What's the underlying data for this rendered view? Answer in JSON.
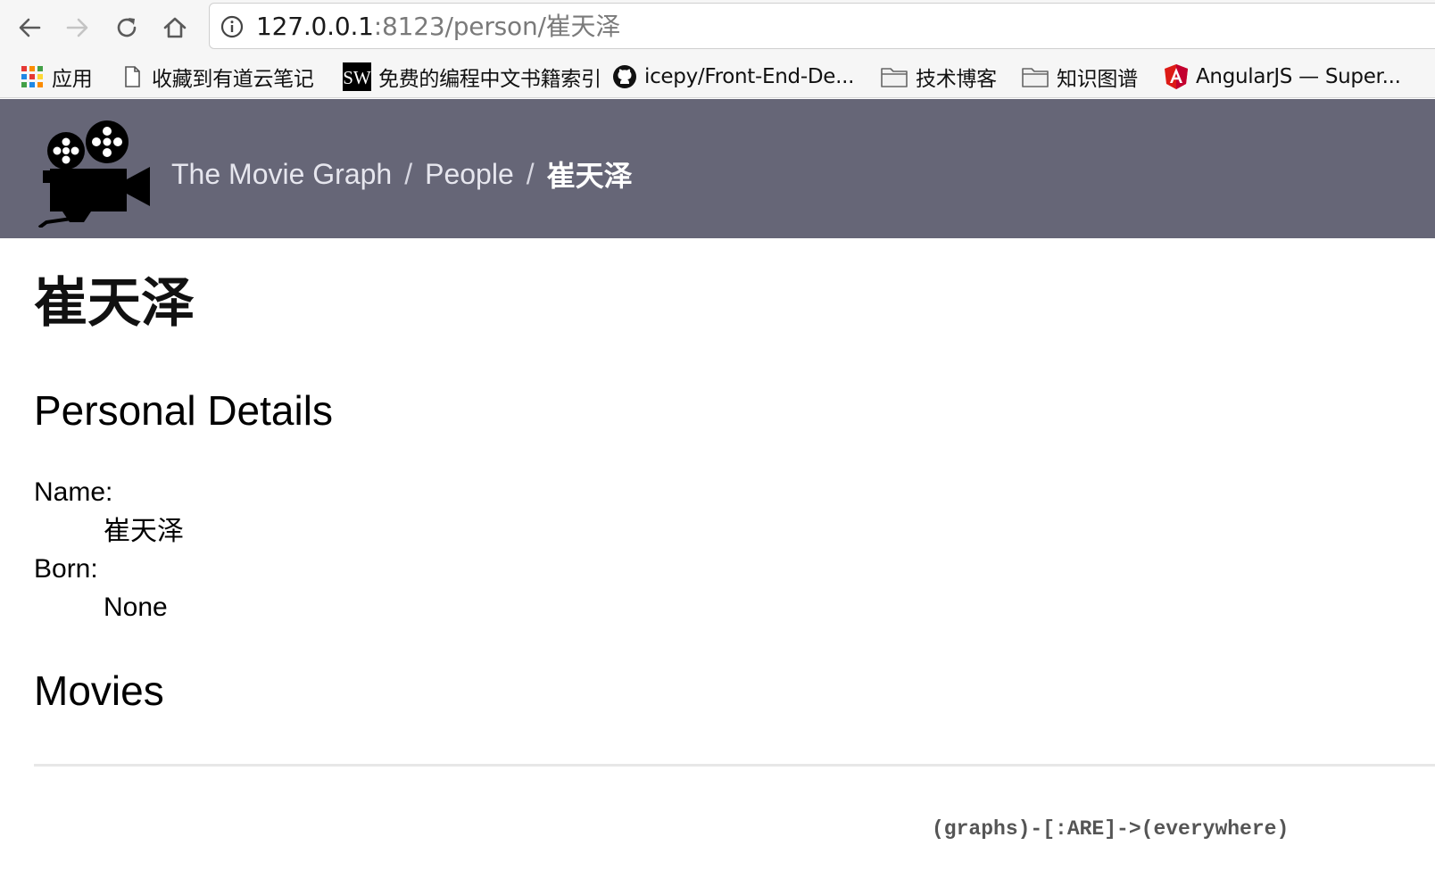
{
  "browser": {
    "url_host": "127.0.0.1",
    "url_path": ":8123/person/崔天泽",
    "bookmarks": [
      {
        "icon": "apps-grid-icon",
        "label": "应用"
      },
      {
        "icon": "page-icon",
        "label": "收藏到有道云笔记"
      },
      {
        "icon": "sw-logo-icon",
        "label": "免费的编程中文书籍索引"
      },
      {
        "icon": "github-icon",
        "label": "icepy/Front-End-De..."
      },
      {
        "icon": "folder-icon",
        "label": "技术博客"
      },
      {
        "icon": "folder-icon",
        "label": "知识图谱"
      },
      {
        "icon": "angular-icon",
        "label": "AngularJS — Super..."
      }
    ],
    "sw_icon_text": "SW"
  },
  "header": {
    "breadcrumb": [
      "The Movie Graph",
      "People",
      "崔天泽"
    ],
    "separator": "/",
    "bg_color": "#666677"
  },
  "main": {
    "title": "崔天泽",
    "details_heading": "Personal Details",
    "details": [
      {
        "label": "Name:",
        "value": "崔天泽"
      },
      {
        "label": "Born:",
        "value": "None"
      }
    ],
    "movies_heading": "Movies"
  },
  "footer": {
    "tagline": "(graphs)-[:ARE]->(everywhere)"
  }
}
